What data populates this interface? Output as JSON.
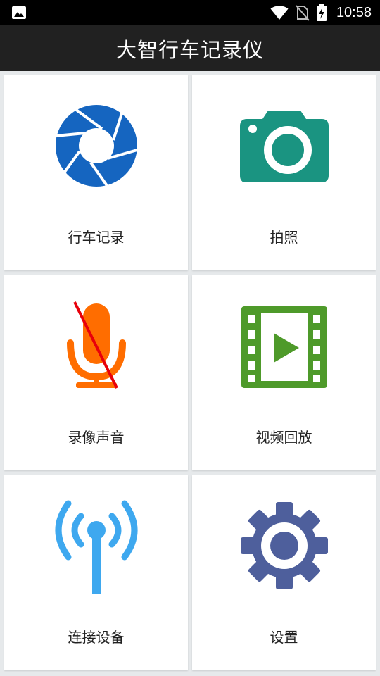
{
  "status_bar": {
    "time": "10:58",
    "icons": [
      "image-notification-icon",
      "wifi-icon",
      "no-sim-icon",
      "battery-charging-icon"
    ]
  },
  "app_bar": {
    "title": "大智行车记录仪"
  },
  "menu": {
    "items": [
      {
        "label": "行车记录",
        "icon": "aperture-icon",
        "color": "#1565c0"
      },
      {
        "label": "拍照",
        "icon": "camera-icon",
        "color": "#1a9481"
      },
      {
        "label": "录像声音",
        "icon": "microphone-muted-icon",
        "color": "#ff6d00"
      },
      {
        "label": "视频回放",
        "icon": "video-film-icon",
        "color": "#4e9a2a"
      },
      {
        "label": "连接设备",
        "icon": "antenna-signal-icon",
        "color": "#3ea8ef"
      },
      {
        "label": "设置",
        "icon": "gear-icon",
        "color": "#4e5f9c"
      }
    ]
  }
}
